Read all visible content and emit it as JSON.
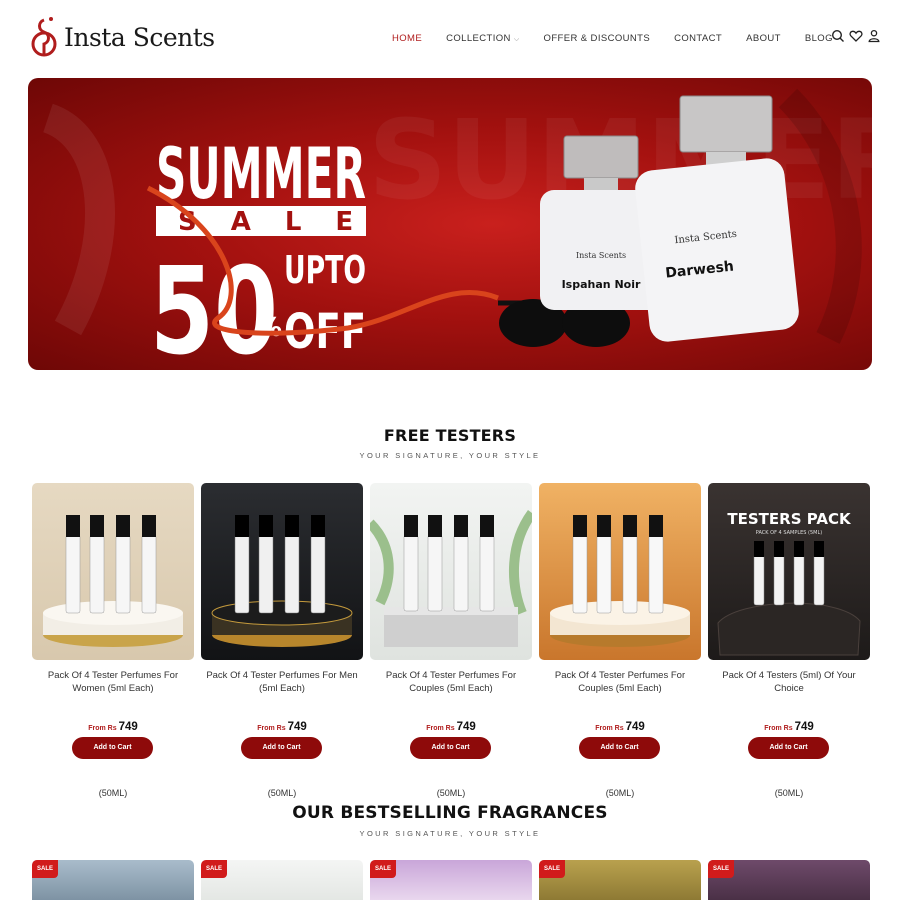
{
  "brand": {
    "name": "Insta Scents"
  },
  "nav": {
    "items": [
      {
        "label": "HOME",
        "active": true
      },
      {
        "label": "COLLECTION",
        "has_dropdown": true
      },
      {
        "label": "OFFER & DISCOUNTS"
      },
      {
        "label": "CONTACT"
      },
      {
        "label": "ABOUT"
      },
      {
        "label": "BLOG"
      }
    ],
    "icons": [
      "search-icon",
      "heart-icon",
      "user-icon"
    ]
  },
  "banner": {
    "headline": "SUMMER",
    "sale_word": "SALE",
    "discount": "50",
    "percent": "%",
    "upto": "UPTO",
    "off": "OFF",
    "bottle_brand": "Insta Scents",
    "bottle_left_name": "Ispahan Noir",
    "bottle_right_name": "Darwesh",
    "colors": {
      "primary": "#a3110f",
      "ribbon": "#d9441c"
    }
  },
  "testers_section": {
    "title": "FREE TESTERS",
    "subtitle": "YOUR SIGNATURE, YOUR STYLE",
    "products": [
      {
        "title": "Pack Of 4 Tester Perfumes For Women (5ml Each)",
        "price_prefix": "From Rs",
        "price": "749",
        "button": "Add to Cart",
        "size": "(50ML)",
        "bg": "#e8dcc7"
      },
      {
        "title": "Pack Of 4 Tester Perfumes For Men (5ml Each)",
        "price_prefix": "From Rs",
        "price": "749",
        "button": "Add to Cart",
        "size": "(50ML)",
        "bg": "#1e1f22"
      },
      {
        "title": "Pack Of 4 Tester Perfumes For Couples (5ml Each)",
        "price_prefix": "From Rs",
        "price": "749",
        "button": "Add to Cart",
        "size": "(50ML)",
        "bg": "#e9ecea"
      },
      {
        "title": "Pack Of 4 Tester Perfumes For Couples (5ml Each)",
        "price_prefix": "From Rs",
        "price": "749",
        "button": "Add to Cart",
        "size": "(50ML)",
        "bg": "#e09a4b"
      },
      {
        "title": "Pack Of 4 Testers (5ml) Of Your Choice",
        "price_prefix": "From Rs",
        "price": "749",
        "button": "Add to Cart",
        "size": "(50ML)",
        "bg": "#2a2624",
        "overlay_title": "TESTERS PACK",
        "overlay_sub": "PACK OF 4 SAMPLES (5ML)"
      }
    ]
  },
  "bestselling_section": {
    "title": "OUR BESTSELLING FRAGRANCES",
    "subtitle": "YOUR SIGNATURE, YOUR STYLE",
    "badge": "SALE"
  }
}
